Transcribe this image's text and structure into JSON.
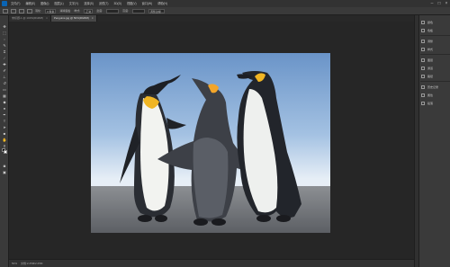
{
  "menubar": {
    "logo": "Ps",
    "items": [
      "文件(F)",
      "编辑(E)",
      "图像(I)",
      "图层(L)",
      "文字(Y)",
      "选择(S)",
      "滤镜(T)",
      "3D(D)",
      "视图(V)",
      "窗口(W)",
      "帮助(H)"
    ],
    "window_controls": [
      "–",
      "□",
      "×"
    ]
  },
  "optionsbar": {
    "items": [
      "羽化:",
      "0 像素",
      "消除锯齿",
      "样式:",
      "正常",
      "宽度:",
      "高度:",
      "调整边缘..."
    ]
  },
  "tabs": [
    {
      "label": "未标题-1 @ 100%(RGB/8)",
      "close": "×"
    },
    {
      "label": "Penguins.jpg @ 50%(RGB/8)",
      "close": "×"
    }
  ],
  "status": {
    "zoom": "50%",
    "info": "文档:2.25M/2.25M"
  },
  "panels": {
    "items": [
      {
        "label": "颜色",
        "icon": "color-icon"
      },
      {
        "label": "色板",
        "icon": "swatches-icon"
      },
      {
        "label": "调整",
        "icon": "adjustments-icon"
      },
      {
        "label": "样式",
        "icon": "styles-icon"
      },
      {
        "label": "图层",
        "icon": "layers-icon"
      },
      {
        "label": "通道",
        "icon": "channels-icon"
      },
      {
        "label": "路径",
        "icon": "paths-icon"
      },
      {
        "label": "历史记录",
        "icon": "history-icon"
      },
      {
        "label": "属性",
        "icon": "properties-icon"
      },
      {
        "label": "段落",
        "icon": "paragraph-icon"
      }
    ]
  },
  "tools": [
    "move",
    "marquee",
    "lasso",
    "quick-select",
    "crop",
    "eyedropper",
    "healing",
    "brush",
    "stamp",
    "history-brush",
    "eraser",
    "gradient",
    "blur",
    "dodge",
    "pen",
    "type",
    "path-select",
    "shape",
    "hand",
    "zoom"
  ],
  "colors": {
    "foreground": "#000000",
    "background": "#ffffff",
    "accent": "#0a64b4"
  }
}
